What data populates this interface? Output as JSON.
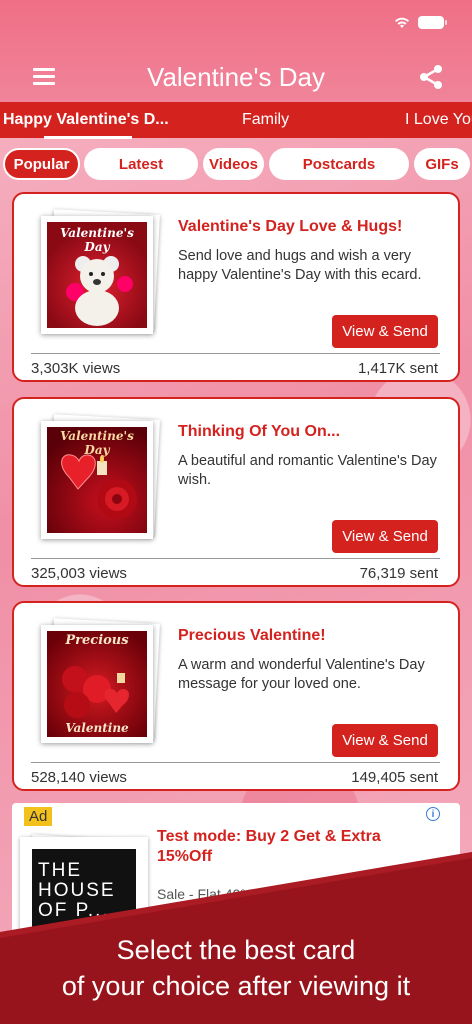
{
  "header": {
    "title": "Valentine's Day"
  },
  "tabs": [
    {
      "label": "Happy Valentine's D..."
    },
    {
      "label": "Family"
    },
    {
      "label": "I Love You"
    }
  ],
  "chips": [
    {
      "label": "Popular"
    },
    {
      "label": "Latest"
    },
    {
      "label": "Videos"
    },
    {
      "label": "Postcards"
    },
    {
      "label": "GIFs"
    }
  ],
  "cards": [
    {
      "image_text": "Valentine's Day",
      "title": "Valentine's Day Love & Hugs!",
      "description": "Send love and hugs and wish a very happy Valentine's Day with this ecard.",
      "button": "View & Send",
      "views": "3,303K views",
      "sent": "1,417K sent"
    },
    {
      "image_text": "Valentine's Day",
      "title": "Thinking Of You On...",
      "description": "A beautiful and romantic Valentine's Day wish.",
      "button": "View & Send",
      "views": "325,003 views",
      "sent": "76,319 sent"
    },
    {
      "image_text_top": "Precious",
      "image_text_bottom": "Valentine",
      "title": "Precious Valentine!",
      "description": "A warm and wonderful Valentine's Day message for your loved one.",
      "button": "View & Send",
      "views": "528,140 views",
      "sent": "149,405 sent"
    }
  ],
  "ad": {
    "badge": "Ad",
    "info": "i",
    "image_text": "THE HOUSE OF P...",
    "title": "Test mode: Buy 2 Get & Extra 15%Off",
    "subtitle": "Sale - Flat 40%"
  },
  "banner": {
    "line1": "Select the best card",
    "line2": "of your choice after viewing it"
  },
  "colors": {
    "primary": "#d4231f",
    "header": "#ef6f86"
  },
  "icons": [
    "menu-icon",
    "share-icon",
    "wifi-icon",
    "battery-icon",
    "info-icon"
  ]
}
